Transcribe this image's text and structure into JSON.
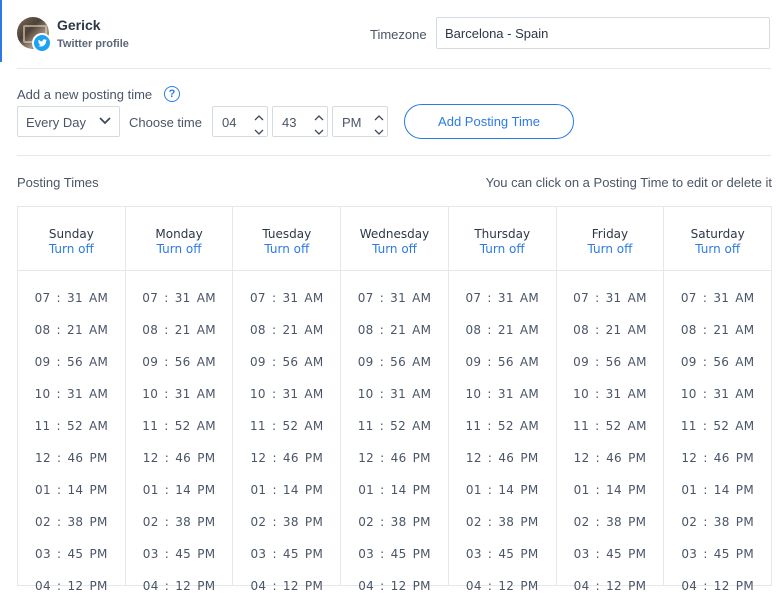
{
  "profile": {
    "name": "Gerick",
    "subtitle": "Twitter profile"
  },
  "timezone": {
    "label": "Timezone",
    "value": "Barcelona - Spain"
  },
  "add_time": {
    "label": "Add a new posting time",
    "frequency": "Every Day",
    "choose_label": "Choose time",
    "hour": "04",
    "minute": "43",
    "ampm": "PM",
    "button": "Add Posting Time"
  },
  "posting_times": {
    "title": "Posting Times",
    "hint": "You can click on a Posting Time to edit or delete it",
    "turn_off_label": "Turn off",
    "days": [
      "Sunday",
      "Monday",
      "Tuesday",
      "Wednesday",
      "Thursday",
      "Friday",
      "Saturday"
    ],
    "times": [
      "07 : 31  AM",
      "08 : 21  AM",
      "09 : 56  AM",
      "10 : 31  AM",
      "11 : 52  AM",
      "12 : 46  PM",
      "01 : 14  PM",
      "02 : 38  PM",
      "03 : 45  PM",
      "04 : 12  PM"
    ]
  },
  "colors": {
    "accent": "#2c7be5",
    "twitter": "#1da1f2",
    "border": "#e4e7eb"
  }
}
